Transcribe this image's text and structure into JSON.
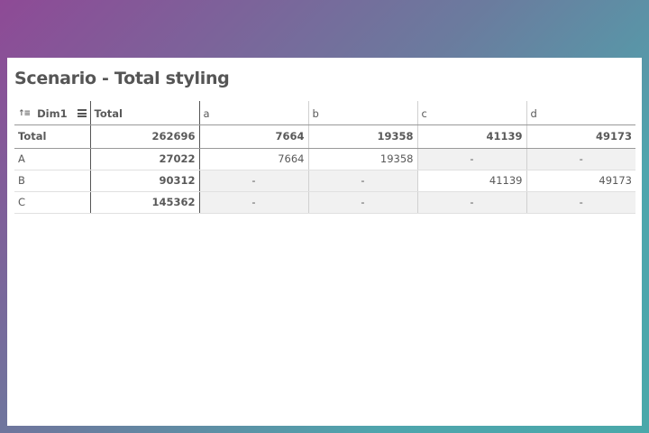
{
  "title": "Scenario - Total styling",
  "table": {
    "dim_header": "Dim1",
    "total_header": "Total",
    "columns": [
      "a",
      "b",
      "c",
      "d"
    ],
    "total_row": {
      "label": "Total",
      "total": "262696",
      "values": [
        "7664",
        "19358",
        "41139",
        "49173"
      ]
    },
    "rows": [
      {
        "label": "A",
        "total": "27022",
        "values": [
          "7664",
          "19358",
          "-",
          "-"
        ]
      },
      {
        "label": "B",
        "total": "90312",
        "values": [
          "-",
          "-",
          "41139",
          "49173"
        ]
      },
      {
        "label": "C",
        "total": "145362",
        "values": [
          "-",
          "-",
          "-",
          "-"
        ]
      }
    ]
  },
  "icons": {
    "sort": "sort-ascending-icon",
    "menu": "hamburger-menu-icon"
  },
  "colors": {
    "background_gradient_start": "#8e4a96",
    "background_gradient_end": "#4aa8aa",
    "shaded_cell": "#f1f1f1",
    "text": "#595959"
  }
}
